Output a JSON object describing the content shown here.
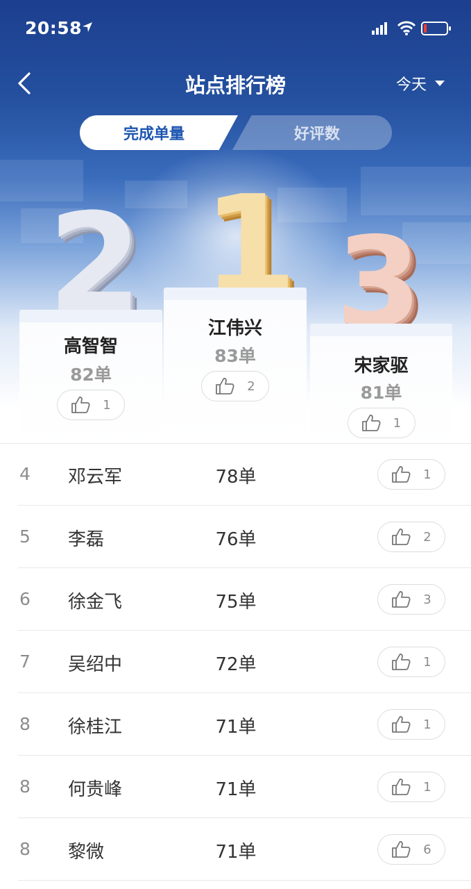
{
  "status_bar": {
    "time": "20:58"
  },
  "nav": {
    "title": "站点排行榜",
    "date_filter": "今天"
  },
  "tabs": [
    {
      "label": "完成单量",
      "active": true
    },
    {
      "label": "好评数",
      "active": false
    }
  ],
  "podium": {
    "first": {
      "rank": "1",
      "name": "江伟兴",
      "count": "83单",
      "likes": "2"
    },
    "second": {
      "rank": "2",
      "name": "高智智",
      "count": "82单",
      "likes": "1"
    },
    "third": {
      "rank": "3",
      "name": "宋家驱",
      "count": "81单",
      "likes": "1"
    }
  },
  "list": [
    {
      "rank": "4",
      "name": "邓云军",
      "count": "78单",
      "likes": "1"
    },
    {
      "rank": "5",
      "name": "李磊",
      "count": "76单",
      "likes": "2"
    },
    {
      "rank": "6",
      "name": "徐金飞",
      "count": "75单",
      "likes": "3"
    },
    {
      "rank": "7",
      "name": "吴绍中",
      "count": "72单",
      "likes": "1"
    },
    {
      "rank": "8",
      "name": "徐桂江",
      "count": "71单",
      "likes": "1"
    },
    {
      "rank": "8",
      "name": "何贵峰",
      "count": "71单",
      "likes": "1"
    },
    {
      "rank": "8",
      "name": "黎微",
      "count": "71单",
      "likes": "6"
    }
  ],
  "colors": {
    "header_blue": "#24509f",
    "active_tab_text": "#1e56b0",
    "gold": "#e8bd6a",
    "silver": "#c4c9d8",
    "bronze": "#d7a593"
  }
}
